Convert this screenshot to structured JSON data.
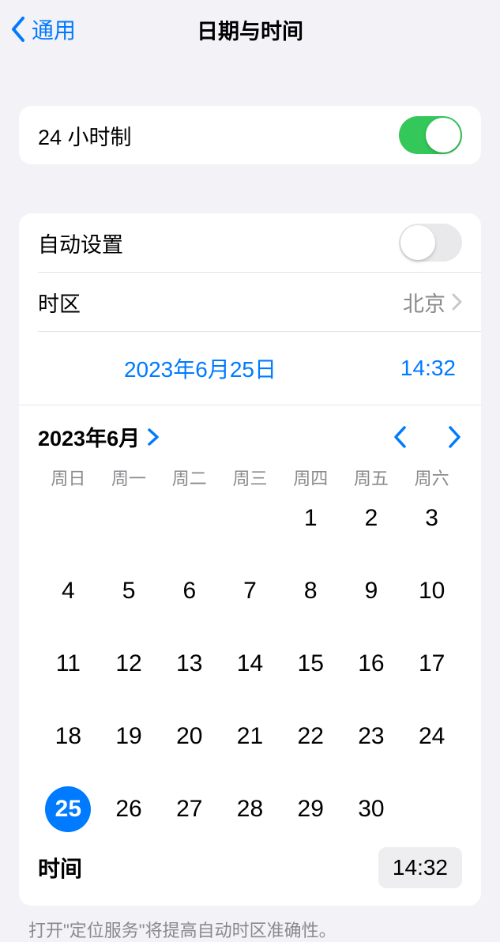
{
  "header": {
    "back_label": "通用",
    "title": "日期与时间"
  },
  "settings": {
    "twenty_four_hour_label": "24 小时制",
    "twenty_four_hour_on": true,
    "auto_set_label": "自动设置",
    "auto_set_on": false,
    "timezone_label": "时区",
    "timezone_value": "北京",
    "selected_date": "2023年6月25日",
    "selected_time": "14:32"
  },
  "calendar": {
    "month_title": "2023年6月",
    "weekdays": [
      "周日",
      "周一",
      "周二",
      "周三",
      "周四",
      "周五",
      "周六"
    ],
    "blank_leading": 4,
    "days": [
      1,
      2,
      3,
      4,
      5,
      6,
      7,
      8,
      9,
      10,
      11,
      12,
      13,
      14,
      15,
      16,
      17,
      18,
      19,
      20,
      21,
      22,
      23,
      24,
      25,
      26,
      27,
      28,
      29,
      30
    ],
    "selected_day": 25,
    "time_label": "时间",
    "time_value": "14:32"
  },
  "footer": {
    "note": "打开\"定位服务\"将提高自动时区准确性。"
  }
}
